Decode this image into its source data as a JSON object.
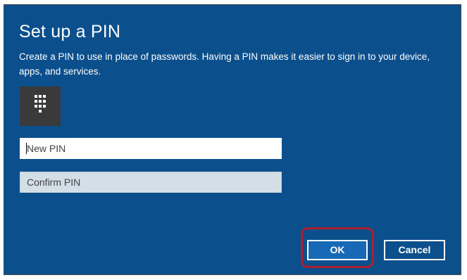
{
  "dialog": {
    "title": "Set up a PIN",
    "description": "Create a PIN to use in place of passwords. Having a PIN makes it easier to sign in to your device, apps, and services.",
    "icon": "keypad-icon"
  },
  "fields": {
    "new_pin": {
      "placeholder": "New PIN",
      "value": ""
    },
    "confirm_pin": {
      "placeholder": "Confirm PIN",
      "value": ""
    }
  },
  "buttons": {
    "ok_label": "OK",
    "cancel_label": "Cancel"
  },
  "colors": {
    "background": "#0b4f8c",
    "tile": "#3a3a3a",
    "ok_button": "#1768b5",
    "highlight": "#b01e2e"
  }
}
